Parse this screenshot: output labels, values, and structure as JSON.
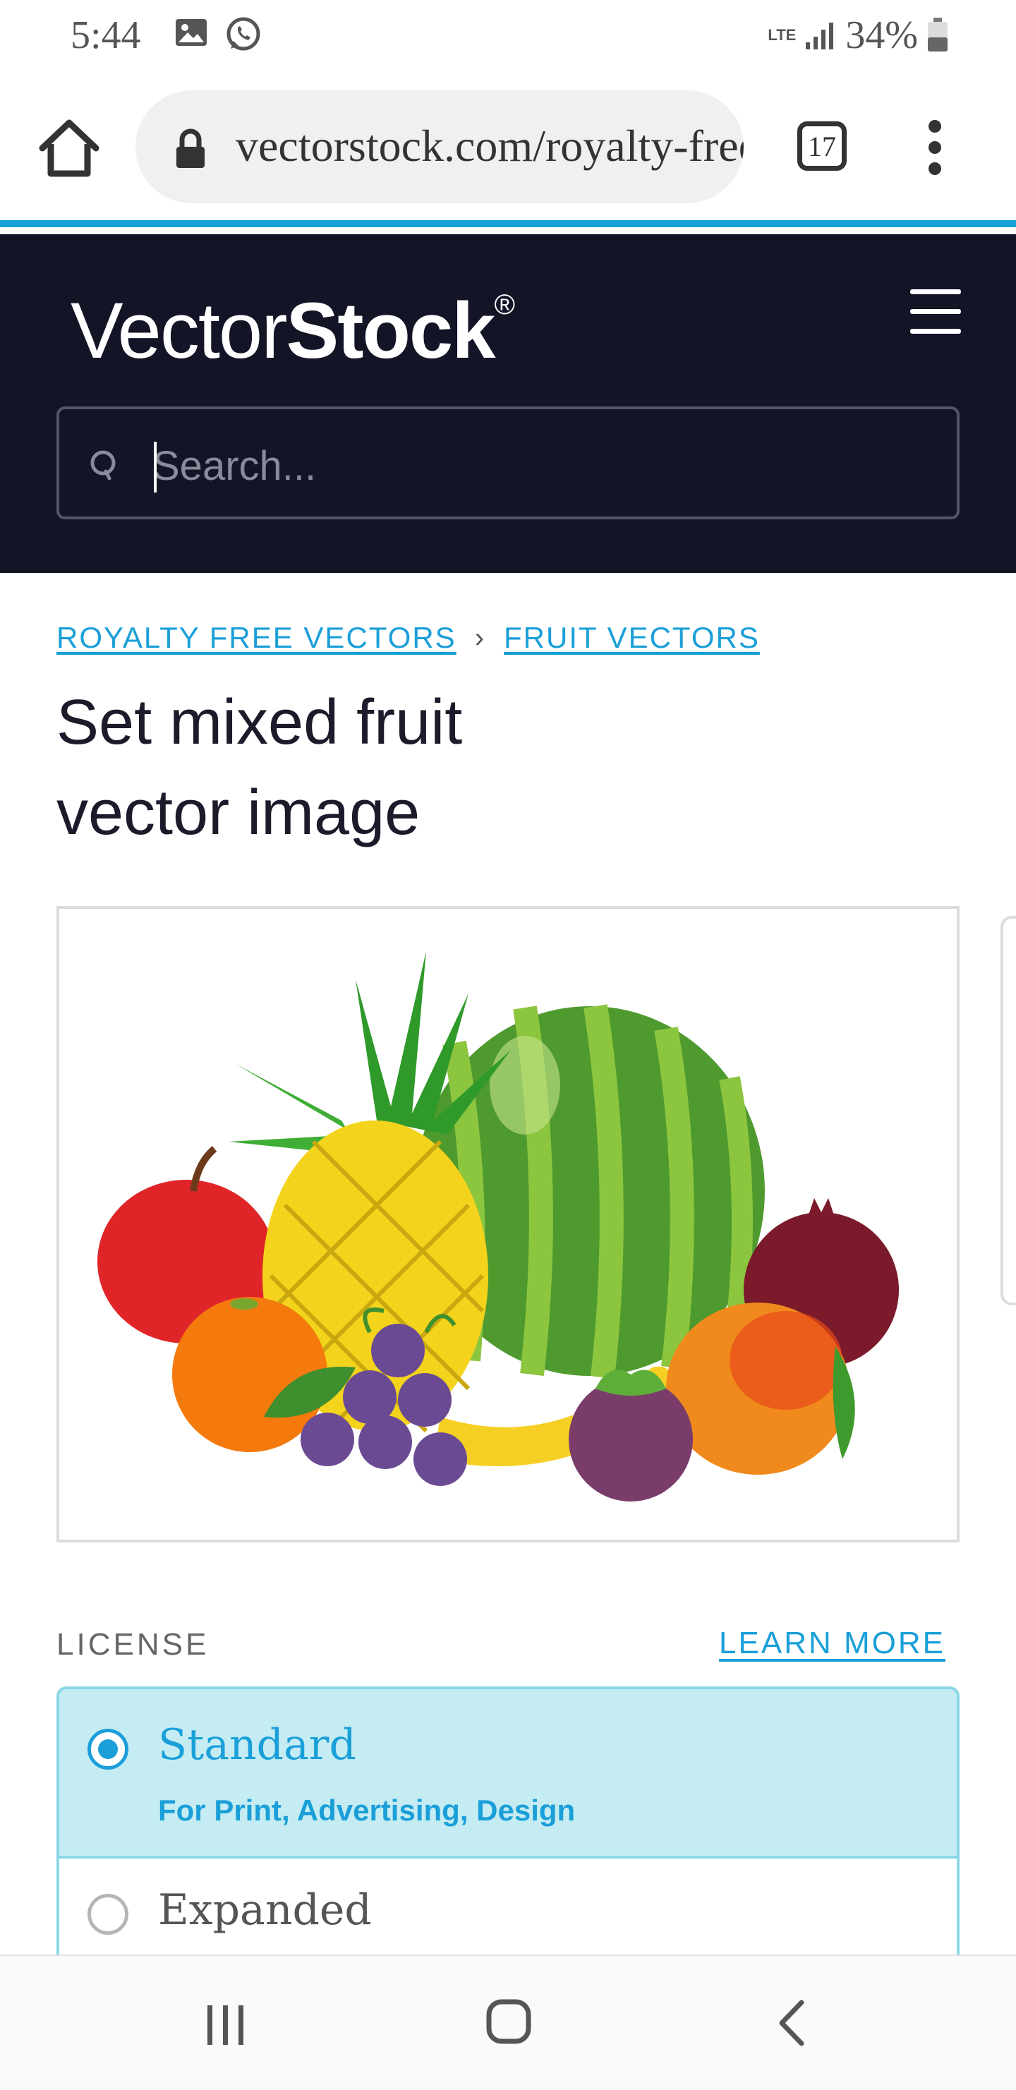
{
  "status_bar": {
    "time": "5:44",
    "network": "LTE",
    "battery": "34%"
  },
  "browser": {
    "url": "vectorstock.com/royalty-free-vector",
    "tab_count": "17"
  },
  "site": {
    "logo_regular": "Vector",
    "logo_bold": "Stock",
    "logo_mark": "®",
    "search_placeholder": "Search..."
  },
  "breadcrumb": {
    "items": [
      "ROYALTY FREE VECTORS",
      "FRUIT VECTORS"
    ],
    "separator": "›"
  },
  "page": {
    "title": "Set mixed fruit vector image"
  },
  "preview": {
    "image_icon": "fruit-illustration"
  },
  "license": {
    "label": "LICENSE",
    "learn_more": "LEARN MORE",
    "options": [
      {
        "title": "Standard",
        "subtitle": "For Print, Advertising, Design",
        "selected": true
      },
      {
        "title": "Expanded",
        "subtitle": "",
        "selected": false
      }
    ]
  },
  "colors": {
    "accent": "#1a9fd8",
    "header_bg": "#131426",
    "selected_bg": "#c5ecf3"
  }
}
